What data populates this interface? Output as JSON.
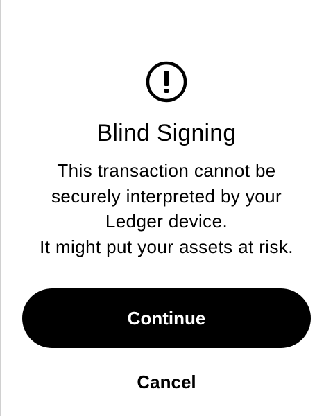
{
  "screen": {
    "icon": "warning-circle-exclamation-icon",
    "title": "Blind Signing",
    "message_lines": [
      "This transaction cannot be",
      "securely interpreted by your",
      "Ledger device.",
      "It might put your assets at risk."
    ],
    "continue_label": "Continue",
    "cancel_label": "Cancel"
  },
  "colors": {
    "background": "#ffffff",
    "primary_button_bg": "#000000",
    "primary_button_text": "#ffffff",
    "text": "#000000"
  }
}
